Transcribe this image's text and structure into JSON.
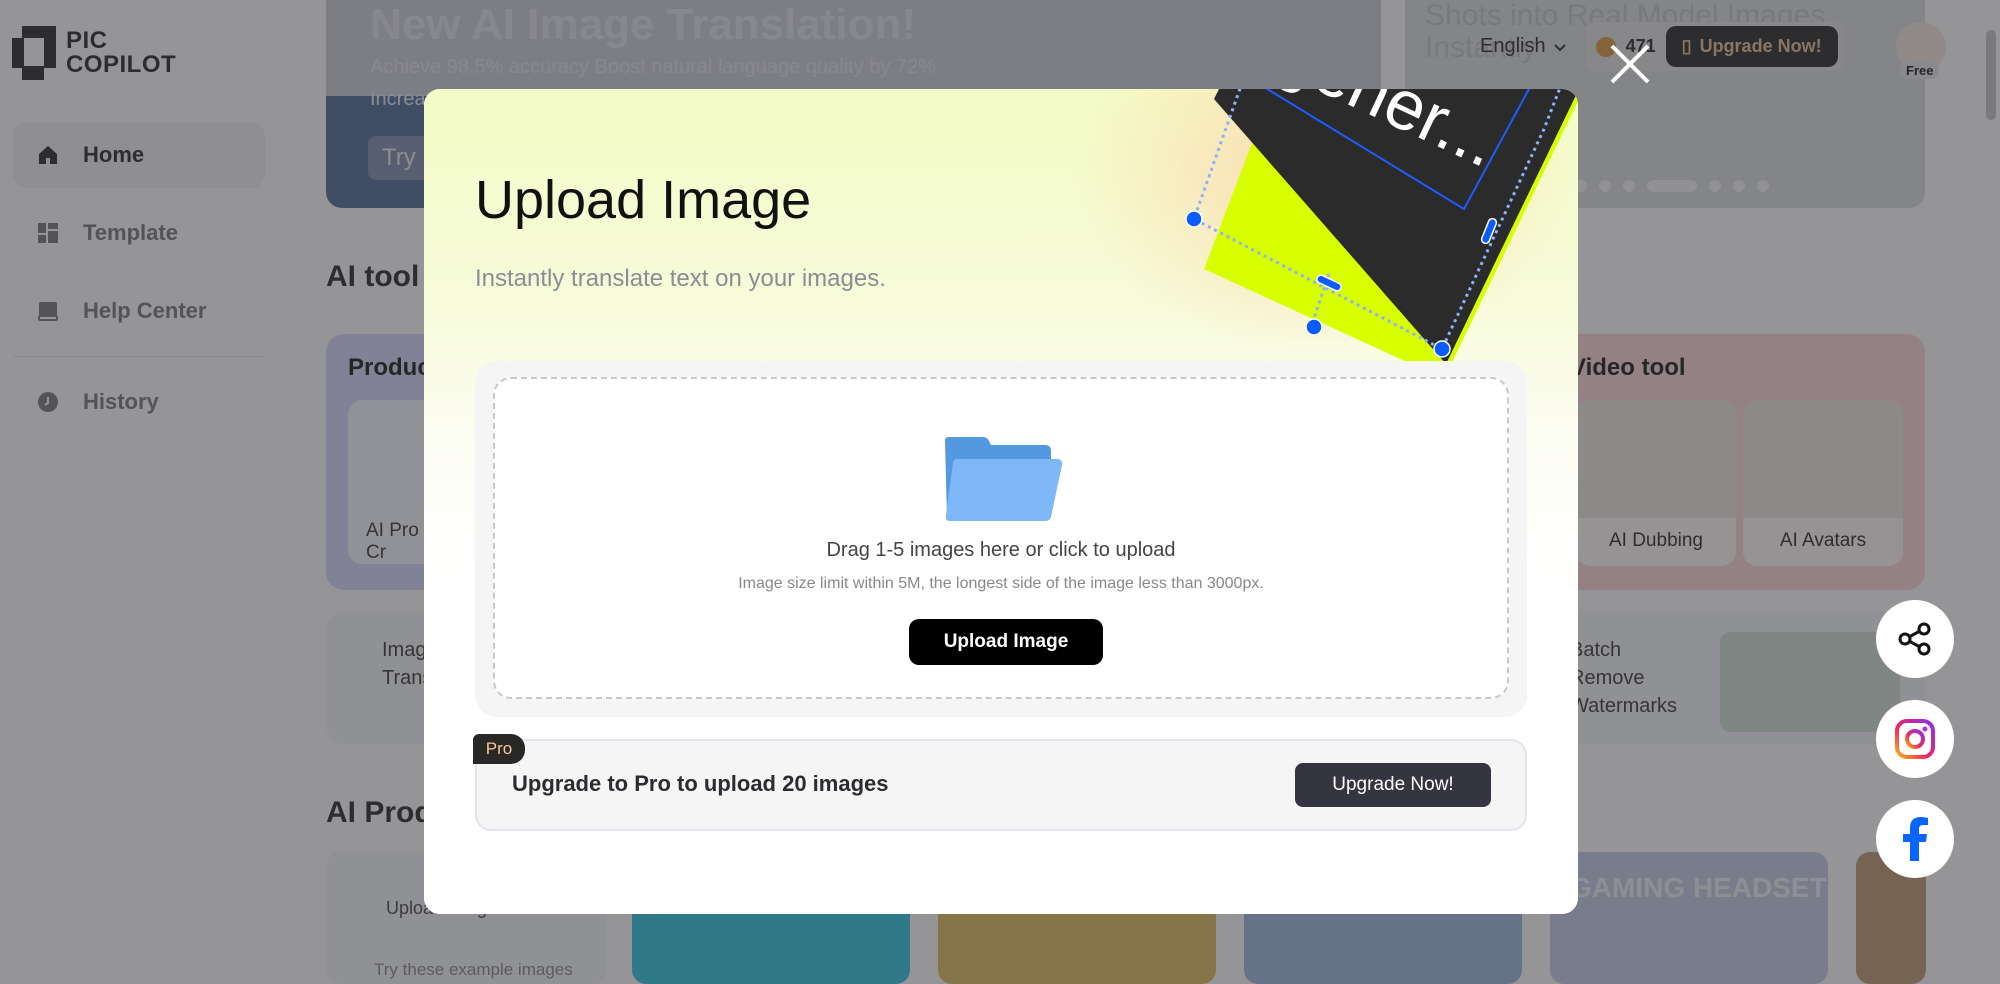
{
  "app": {
    "logo_line1": "PIC",
    "logo_line2": "COPILOT"
  },
  "sidebar": {
    "items": [
      {
        "label": "Home",
        "icon": "home-icon",
        "active": true
      },
      {
        "label": "Template",
        "icon": "template-icon",
        "active": false
      },
      {
        "label": "Help Center",
        "icon": "book-icon",
        "active": false
      },
      {
        "label": "History",
        "icon": "clock-icon",
        "active": false
      }
    ]
  },
  "header": {
    "language": "English",
    "credits": "471",
    "upgrade_label": "Upgrade Now!",
    "plan_badge": "Free"
  },
  "background": {
    "banner_title": "New AI Image Translation!",
    "banner_sub": "Achieve 98.5% accuracy    Boost natural language quality by 72%",
    "banner_incr": "Increa",
    "banner_try": "Try",
    "banner_right_text": "Shots into Real Model Images Instantly",
    "section_ai_tools": "AI tool",
    "product_card_title": "Produc",
    "product_card_label": "AI Pro\nCr",
    "video_card_title": "Video tool",
    "video_items": [
      "AI Dubbing",
      "AI Avatars"
    ],
    "image_translate_label": "Image\nTranslat",
    "batch_label": "Batch\nRemove\nWatermarks",
    "section_ai_prod": "AI Prod",
    "upload_image_bg": "Upload image",
    "example_images": "Try these example images",
    "gaming_headset": "GAMING HEADSET"
  },
  "modal": {
    "title": "Upload Image",
    "subtitle": "Instantly translate text on your images.",
    "deco_text": "gener...",
    "dropzone": {
      "main_text": "Drag 1-5 images here or click to upload",
      "hint_text": "Image size limit within 5M, the longest side of the image less than 3000px.",
      "button_label": "Upload Image"
    },
    "pro": {
      "badge": "Pro",
      "text": "Upgrade to Pro to upload 20 images",
      "button_label": "Upgrade Now!"
    }
  },
  "colors": {
    "accent_lime": "#d7ff00",
    "handle_blue": "#0a5cff",
    "folder_blue": "#7fb8f8",
    "pro_badge_text": "#f4c895"
  },
  "floating": [
    "share-icon",
    "instagram-icon",
    "facebook-icon"
  ]
}
